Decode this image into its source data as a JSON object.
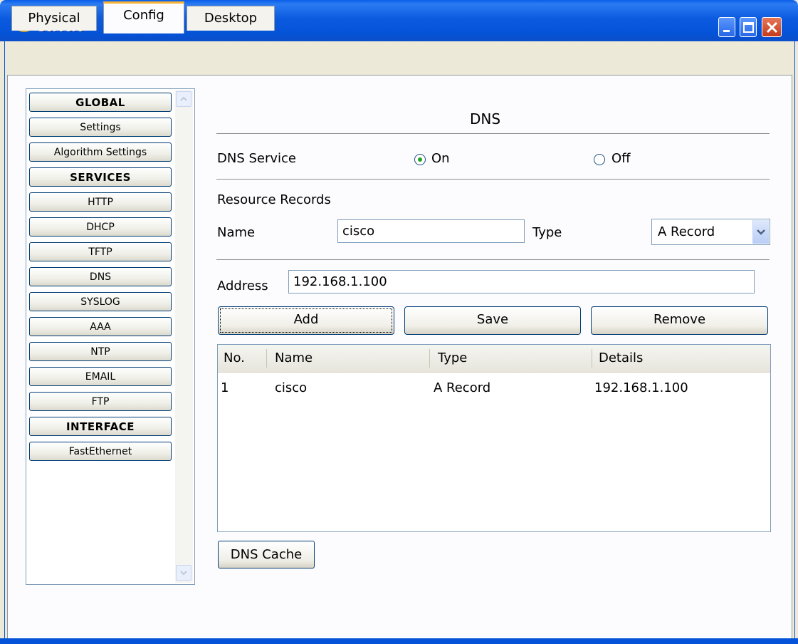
{
  "window": {
    "title": "Server0"
  },
  "tabs": [
    {
      "label": "Physical"
    },
    {
      "label": "Config"
    },
    {
      "label": "Desktop"
    }
  ],
  "sidebar": {
    "items": [
      {
        "label": "GLOBAL",
        "header": true
      },
      {
        "label": "Settings"
      },
      {
        "label": "Algorithm Settings"
      },
      {
        "label": "SERVICES",
        "header": true
      },
      {
        "label": "HTTP"
      },
      {
        "label": "DHCP"
      },
      {
        "label": "TFTP"
      },
      {
        "label": "DNS"
      },
      {
        "label": "SYSLOG"
      },
      {
        "label": "AAA"
      },
      {
        "label": "NTP"
      },
      {
        "label": "EMAIL"
      },
      {
        "label": "FTP"
      },
      {
        "label": "INTERFACE",
        "header": true
      },
      {
        "label": "FastEthernet"
      }
    ]
  },
  "dns": {
    "title": "DNS",
    "service_label": "DNS Service",
    "on_label": "On",
    "off_label": "Off",
    "service_on": true,
    "records_label": "Resource Records",
    "name_label": "Name",
    "name_value": "cisco",
    "type_label": "Type",
    "type_value": "A Record",
    "address_label": "Address",
    "address_value": "192.168.1.100",
    "add_label": "Add",
    "save_label": "Save",
    "remove_label": "Remove",
    "cache_label": "DNS Cache"
  },
  "table": {
    "headers": {
      "no": "No.",
      "name": "Name",
      "type": "Type",
      "details": "Details"
    },
    "rows": [
      {
        "no": "1",
        "name": "cisco",
        "type": "A Record",
        "details": "192.168.1.100"
      }
    ]
  },
  "colors": {
    "titlebar": "#0453d8",
    "tab_active_accent": "#f6b333",
    "radio_dot": "#21a121"
  }
}
